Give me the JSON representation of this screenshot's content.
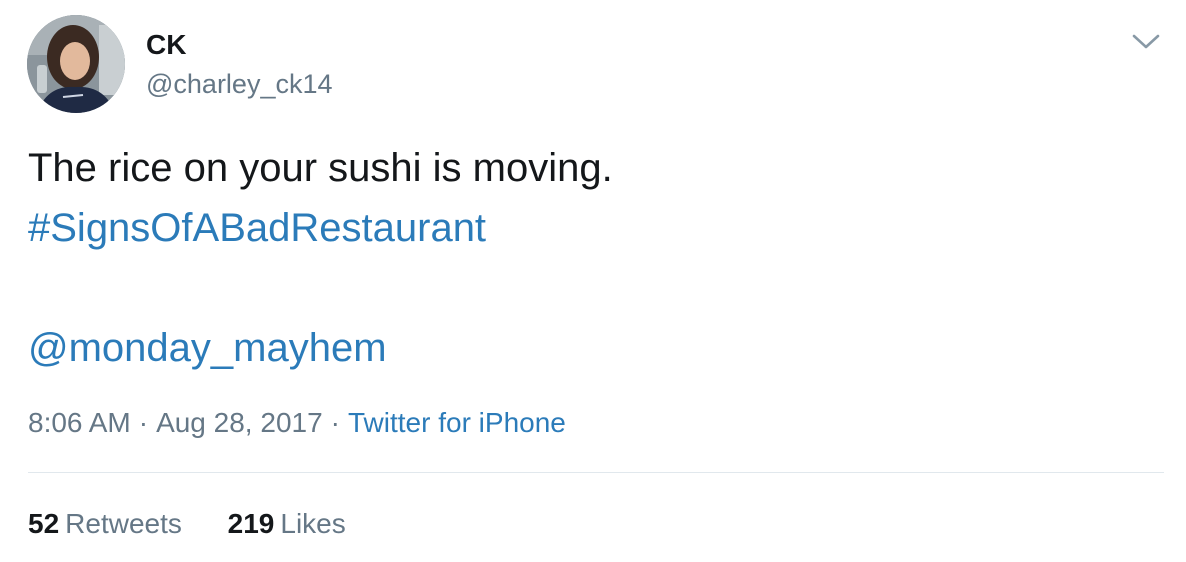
{
  "author": {
    "display_name": "CK",
    "handle": "@charley_ck14",
    "avatar_icon": "profile-photo"
  },
  "menu": {
    "icon": "chevron-down-icon"
  },
  "tweet": {
    "text_line": "The rice on your sushi is moving.",
    "hashtag": "#SignsOfABadRestaurant",
    "mention": "@monday_mayhem"
  },
  "meta": {
    "time": "8:06 AM",
    "separator": "·",
    "date": "Aug 28, 2017",
    "source": "Twitter for iPhone"
  },
  "stats": {
    "retweets_count": "52",
    "retweets_label": "Retweets",
    "likes_count": "219",
    "likes_label": "Likes"
  },
  "colors": {
    "link": "#2b7bb9",
    "secondary_text": "#657786",
    "primary_text": "#14171a",
    "divider": "#e1e8ed"
  }
}
